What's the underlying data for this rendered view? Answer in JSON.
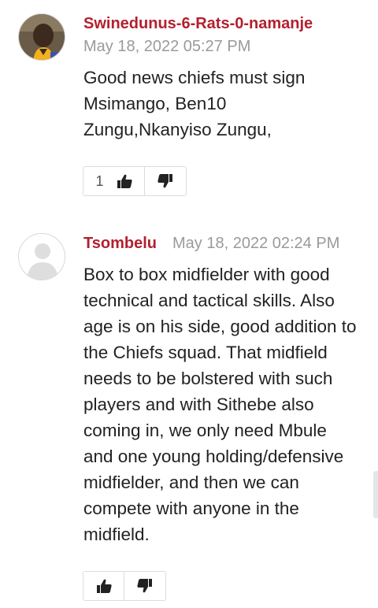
{
  "comments": [
    {
      "author": "Swinedunus-6-Rats-0-namanje",
      "date": "May 18, 2022 05:27 PM",
      "text": "Good news chiefs must sign Msimango, Ben10 Zungu,Nkanyiso Zungu,",
      "upvotes": "1"
    },
    {
      "author": "Tsombelu",
      "date": "May 18, 2022 02:24 PM",
      "text": "Box to box midfielder with good technical and tactical skills. Also age is on his side, good addition to the Chiefs squad. That midfield needs to be bolstered with such players and with Sithebe also coming in, we only need Mbule and one young holding/defensive midfielder, and then we can compete with anyone in the midfield.",
      "upvotes": ""
    }
  ],
  "icons": {
    "upvote": "thumbs-up-icon",
    "downvote": "thumbs-down-icon"
  },
  "colors": {
    "author": "#b3202f",
    "date": "#9a9a9a"
  }
}
